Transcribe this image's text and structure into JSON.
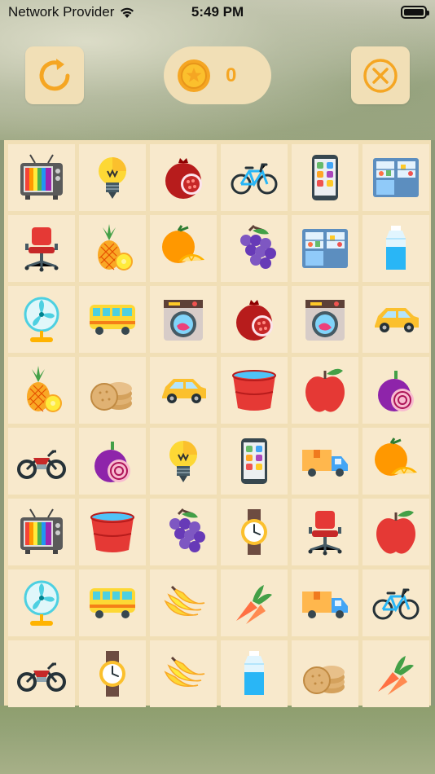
{
  "status_bar": {
    "carrier": "Network Provider",
    "time": "5:49 PM"
  },
  "header": {
    "coins": "0"
  },
  "colors": {
    "accent": "#f5a623",
    "panel": "#f1dfb6",
    "tile": "#f8e9cc"
  },
  "board": {
    "rows": [
      [
        "tv",
        "light-bulb",
        "pomegranate",
        "bicycle",
        "smartphone",
        "refrigerator"
      ],
      [
        "office-chair",
        "pineapple",
        "orange",
        "grapes",
        "refrigerator",
        "water-bottle"
      ],
      [
        "fan",
        "bus",
        "washing-machine",
        "pomegranate",
        "washing-machine",
        "car"
      ],
      [
        "pineapple",
        "cookies",
        "car",
        "bucket",
        "apple",
        "onion"
      ],
      [
        "motorcycle",
        "onion",
        "light-bulb",
        "smartphone",
        "delivery-truck",
        "orange"
      ],
      [
        "tv",
        "bucket",
        "grapes",
        "wristwatch",
        "office-chair",
        "apple"
      ],
      [
        "fan",
        "bus",
        "banana",
        "carrot",
        "delivery-truck",
        "bicycle"
      ],
      [
        "motorcycle",
        "wristwatch",
        "banana",
        "water-bottle",
        "cookies",
        "carrot"
      ]
    ]
  }
}
